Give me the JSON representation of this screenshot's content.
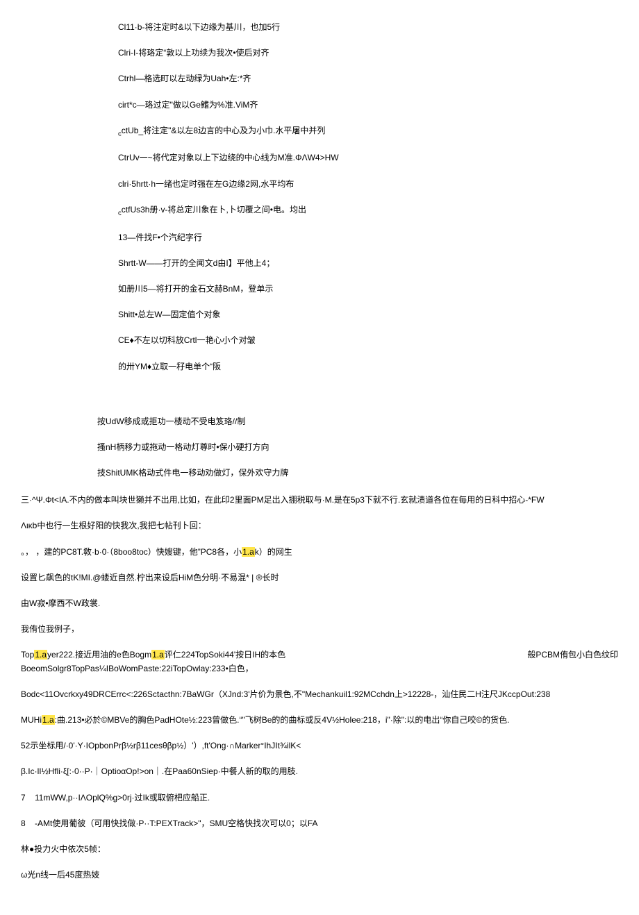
{
  "indent": {
    "l1": "Cl11·b-将注定时&以下边缘为基川，也加5行",
    "l2": "Clri-I-将珞定“敦以上功续为我次•使后对齐",
    "l3": "Ctrhl—格选町以左动绿为Uah•左:*齐",
    "l4": "cirt*c—珞过定\"做以Ge鰭为%准.ViM齐",
    "l5": "ctUb_将注定\"&以左8边言的中心及为小巾.水平屠中并列",
    "l6": "CtrUv一~将代定对象以上下边绕的中心线为M准.ΦΛW4>HW",
    "l7": "clri·5hrtt·h一绪也定时强在左G边缘2网,水平均布",
    "l8": "ctfUs3h册·v-将总定川象在卜,卜切覆之间•电。均出",
    "l9": "13—件找F•个汽纪字行",
    "l10": "Shrtt-W——打开的全闻文d由I】平他上4；",
    "l11": "如册川5—将打开的金石文赫BnM，登单示",
    "l12": "Shitt•总左W—固定值个对象",
    "l13": "CE♦不左以切科放Crtl一艳心小个对皱",
    "l14": "的卅YM♦立取一秄电单个“阪"
  },
  "sub": {
    "s1": "按UdW移成或拒功一楼动不受电笈珞//制",
    "s2": "搔nH柄移力或拖动一格动灯尊时•保小硬打方向",
    "s3": "技ShitUMK格动式件电一移动劝做灯，保外欢守力牌"
  },
  "body": {
    "p1": "三·^Ψ.Φt<IA.不内的做本叫块世獭并不出用,比如，在此印2里面PM足出入掤税取与·M.是在5p3下就不行.玄就渍道各位在毎用的日科中招心-*FW",
    "p2": "Λικb中也行一生根好阳的快我次,我把七帖刊卜回：",
    "p3a": "，建的PC8T.敎·b·0·（8boo8toc）快嫂键，他”PC8各，小",
    "p3b": "1.a",
    "p3c": "k）的网生",
    "p3pre": "。，",
    "p4": "设置匕飙色的tK!MI.@蝼近自然.柠出来设后HiM色分明·不易混* | ®长时",
    "p5": "由W寂•摩西不W政裳.",
    "p6": "我侑位我例子，",
    "p7a": "Top",
    "p7b": "1.a",
    "p7c": "yer222.接近用油的e色Bogm",
    "p7d": "1.a",
    "p7e": "评仁224TopSoki44'按日IH的本色BoeomSolgr8TopPas¼IBoWomPaste:22iTopOwlay:233•白色，",
    "p7right": "般PCBM侑包小白色纹印",
    "p8": "Bodc<11Ovcrkxy49DRCErrc<:226Sctacthn:7BaWGr（XJnd:3'片价为景色,不\"Mechankuil1:92MCchdn上>12228-，汕住民二H注尺JKccpOut:238",
    "p9a": "MUHi",
    "p9b": "1.a",
    "p9c": ":曲.213•必於©MBVe的胸色PadHOte½:223曾做色.“\"飞树Be的的曲标或反4V½Holee:218，i\"·除\":以的电出“你自己咬©的货色.",
    "p10": "52示坐标用/·0'·Y·IOpbonPrβ½rβ11cesθβp½）'）,ft'Ong·∩Marker°IhJIt¾ilK<",
    "p11": "β.Ic·lI½Hfli·ξ[:·0··P·｜OptioαOp!>on｜.在Paa60nSiep·中餐人新的取的用肢.",
    "p12": "7    11mWW,p··IΛOplQ%g>0rj·过Ik或取俯杷应船正.",
    "p13": "8    -AMt使用葡彼（可用快找做·P··T:PEXTrack>\"，SMU空格快找次可以0；以FA",
    "p14": "林●投力火中依次5帧：",
    "p15": "ω光n线一后45度热妓"
  }
}
